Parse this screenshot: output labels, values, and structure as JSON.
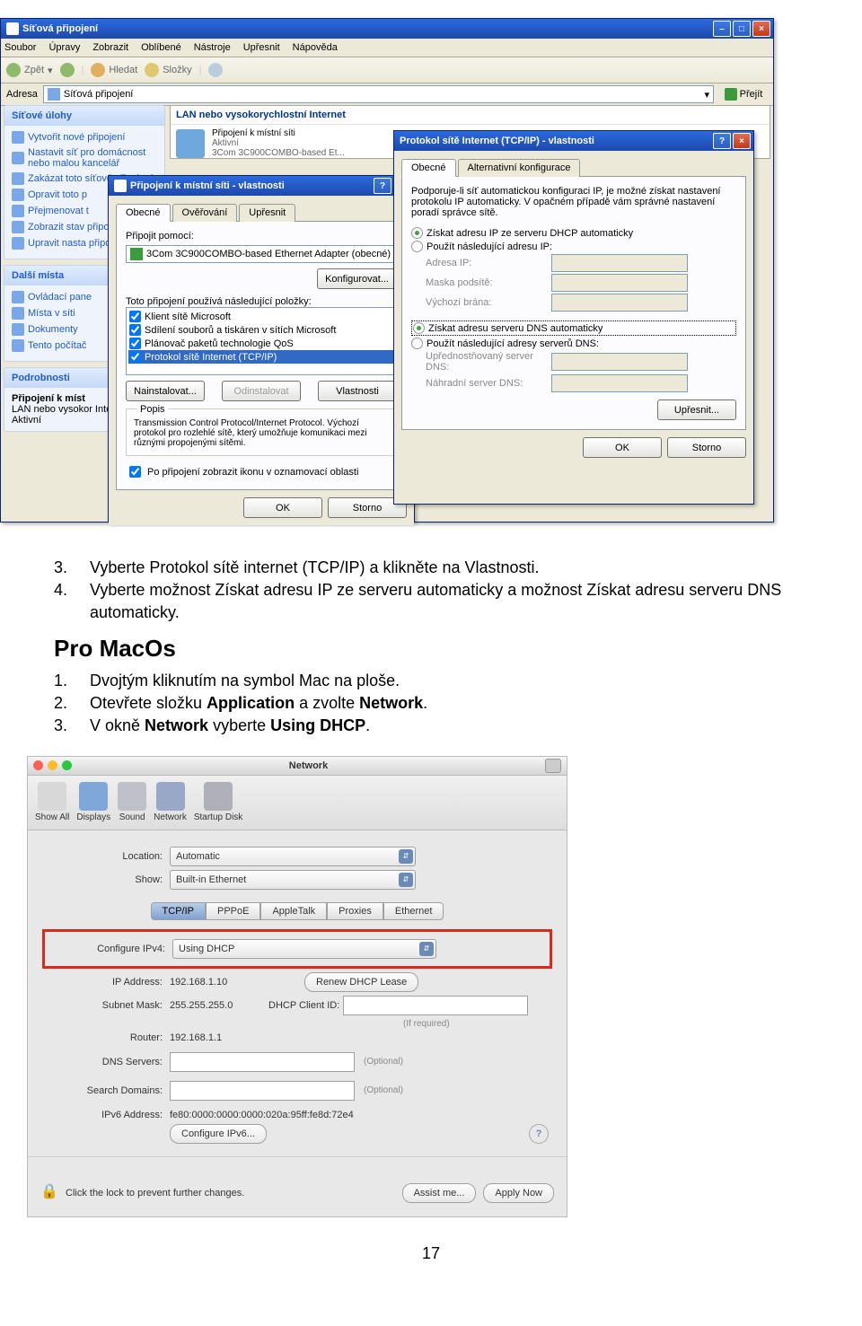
{
  "explorer": {
    "title": "Síťová připojení",
    "menus": [
      "Soubor",
      "Úpravy",
      "Zobrazit",
      "Oblíbené",
      "Nástroje",
      "Upřesnit",
      "Nápověda"
    ],
    "back": "Zpět",
    "search": "Hledat",
    "folders": "Složky",
    "addr_label": "Adresa",
    "addr_value": "Síťová připojení",
    "go": "Přejít",
    "group_lan": "LAN nebo vysokorychlostní Internet",
    "item_name": "Připojení k místní síti",
    "item_state": "Aktivní",
    "item_dev": "3Com 3C900COMBO-based Et...",
    "tasks": {
      "head": "Síťové úlohy",
      "items": [
        "Vytvořit nové připojení",
        "Nastavit síť pro domácnost nebo malou kancelář",
        "Zakázat toto síťové připojení",
        "Opravit toto p",
        "Přejmenovat t",
        "Zobrazit stav připojení",
        "Upravit nasta připojení"
      ]
    },
    "places": {
      "head": "Další místa",
      "items": [
        "Ovládací pane",
        "Místa v síti",
        "Dokumenty",
        "Tento počítač"
      ]
    },
    "details": {
      "head": "Podrobnosti",
      "lines": [
        "Připojení k míst",
        "LAN nebo vysokor Internet",
        "Aktivní"
      ]
    }
  },
  "lanprops": {
    "title": "Připojení k místní síti - vlastnosti",
    "tabs": [
      "Obecné",
      "Ověřování",
      "Upřesnit"
    ],
    "connect_label": "Připojit pomocí:",
    "adapter": "3Com 3C900COMBO-based Ethernet Adapter (obecné)",
    "config": "Konfigurovat...",
    "uses": "Toto připojení používá následující položky:",
    "items": [
      "Klient sítě Microsoft",
      "Sdílení souborů a tiskáren v sítích Microsoft",
      "Plánovač paketů technologie QoS",
      "Protokol sítě Internet (TCP/IP)"
    ],
    "install": "Nainstalovat...",
    "uninstall": "Odinstalovat",
    "props": "Vlastnosti",
    "descr_head": "Popis",
    "descr": "Transmission Control Protocol/Internet Protocol. Výchozí protokol pro rozlehlé sítě, který umožňuje komunikaci mezi různými propojenými sítěmi.",
    "trayopt": "Po připojení zobrazit ikonu v oznamovací oblasti",
    "ok": "OK",
    "cancel": "Storno"
  },
  "tcpip": {
    "title": "Protokol sítě Internet (TCP/IP) - vlastnosti",
    "tabs": [
      "Obecné",
      "Alternativní konfigurace"
    ],
    "intro": "Podporuje-li síť automatickou konfiguraci IP, je možné získat nastavení protokolu IP automaticky. V opačném případě vám správné nastavení poradí správce sítě.",
    "r1": "Získat adresu IP ze serveru DHCP automaticky",
    "r2": "Použít následující adresu IP:",
    "ip": "Adresa IP:",
    "mask": "Maska podsítě:",
    "gw": "Výchozí brána:",
    "r3": "Získat adresu serveru DNS automaticky",
    "r4": "Použít následující adresy serverů DNS:",
    "dns1": "Upřednostňovaný server DNS:",
    "dns2": "Náhradní server DNS:",
    "adv": "Upřesnit...",
    "ok": "OK",
    "cancel": "Storno"
  },
  "doc": {
    "li3": "Vyberte Protokol sítě internet (TCP/IP) a klikněte na Vlastnosti.",
    "li4": "Vyberte možnost Získat adresu IP ze serveru automaticky a možnost Získat adresu serveru DNS automaticky.",
    "head": "Pro MacOs",
    "m1": "Dvojtým kliknutím na symbol Mac na ploše.",
    "m2_a": "Otevřete složku ",
    "m2_b": "Application",
    "m2_c": " a zvolte ",
    "m2_d": "Network",
    "m2_e": ".",
    "m3_a": "V okně ",
    "m3_b": "Network",
    "m3_c": " vyberte ",
    "m3_d": "Using DHCP",
    "m3_e": "."
  },
  "mac": {
    "title": "Network",
    "tools": [
      "Show All",
      "Displays",
      "Sound",
      "Network",
      "Startup Disk"
    ],
    "location_l": "Location:",
    "location_v": "Automatic",
    "show_l": "Show:",
    "show_v": "Built-in Ethernet",
    "tabs": [
      "TCP/IP",
      "PPPoE",
      "AppleTalk",
      "Proxies",
      "Ethernet"
    ],
    "cfg_l": "Configure IPv4:",
    "cfg_v": "Using DHCP",
    "ip_l": "IP Address:",
    "ip_v": "192.168.1.10",
    "renew": "Renew DHCP Lease",
    "mask_l": "Subnet Mask:",
    "mask_v": "255.255.255.0",
    "client_l": "DHCP Client ID:",
    "ifreq": "(If required)",
    "router_l": "Router:",
    "router_v": "192.168.1.1",
    "dns_l": "DNS Servers:",
    "opt": "(Optional)",
    "search_l": "Search Domains:",
    "ipv6_l": "IPv6 Address:",
    "ipv6_v": "fe80:0000:0000:0000:020a:95ff:fe8d:72e4",
    "cfg6": "Configure IPv6...",
    "lock": "Click the lock to prevent further changes.",
    "assist": "Assist me...",
    "apply": "Apply Now"
  },
  "page": "17"
}
